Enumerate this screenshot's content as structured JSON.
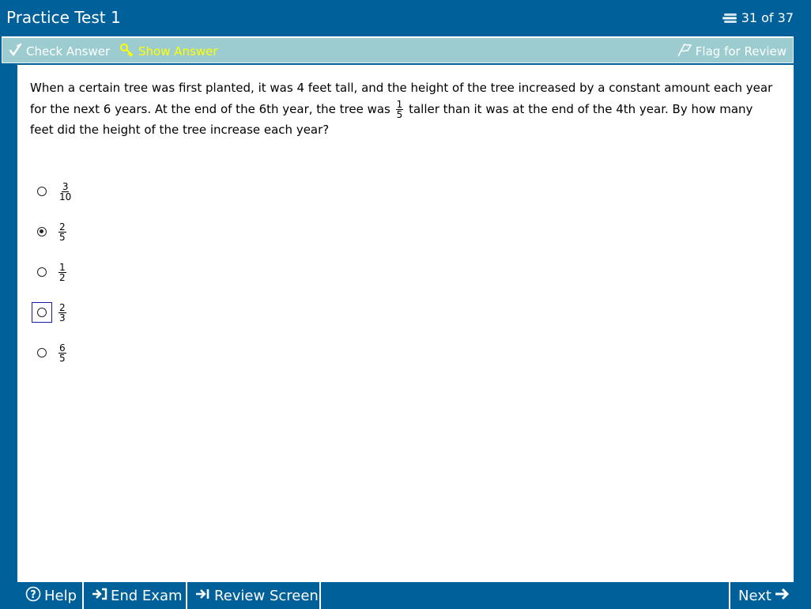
{
  "header": {
    "title": "Practice Test 1",
    "counter": "31 of 37"
  },
  "toolbar": {
    "check_answer": "Check Answer",
    "show_answer": "Show Answer",
    "flag_review": "Flag for Review"
  },
  "question": {
    "text_part1": "When a certain tree was first planted, it was 4 feet tall, and the height of the tree increased by a constant amount each year for the next 6 years.  At the end of the 6th year, the tree was",
    "fraction": {
      "num": "1",
      "den": "5"
    },
    "text_part2": "taller than it was at the end of the 4th year.  By how many feet did the height of the tree increase each year?"
  },
  "choices": [
    {
      "num": "3",
      "den": "10",
      "selected": false,
      "focused": false
    },
    {
      "num": "2",
      "den": "5",
      "selected": true,
      "focused": false
    },
    {
      "num": "1",
      "den": "2",
      "selected": false,
      "focused": false
    },
    {
      "num": "2",
      "den": "3",
      "selected": false,
      "focused": true
    },
    {
      "num": "6",
      "den": "5",
      "selected": false,
      "focused": false
    }
  ],
  "footer": {
    "help": "Help",
    "end_exam": "End Exam",
    "review_screen": "Review Screen",
    "next": "Next"
  },
  "colors": {
    "frame": "#00609a",
    "toolbar": "#9ccccf",
    "show_answer": "#ffff00"
  }
}
